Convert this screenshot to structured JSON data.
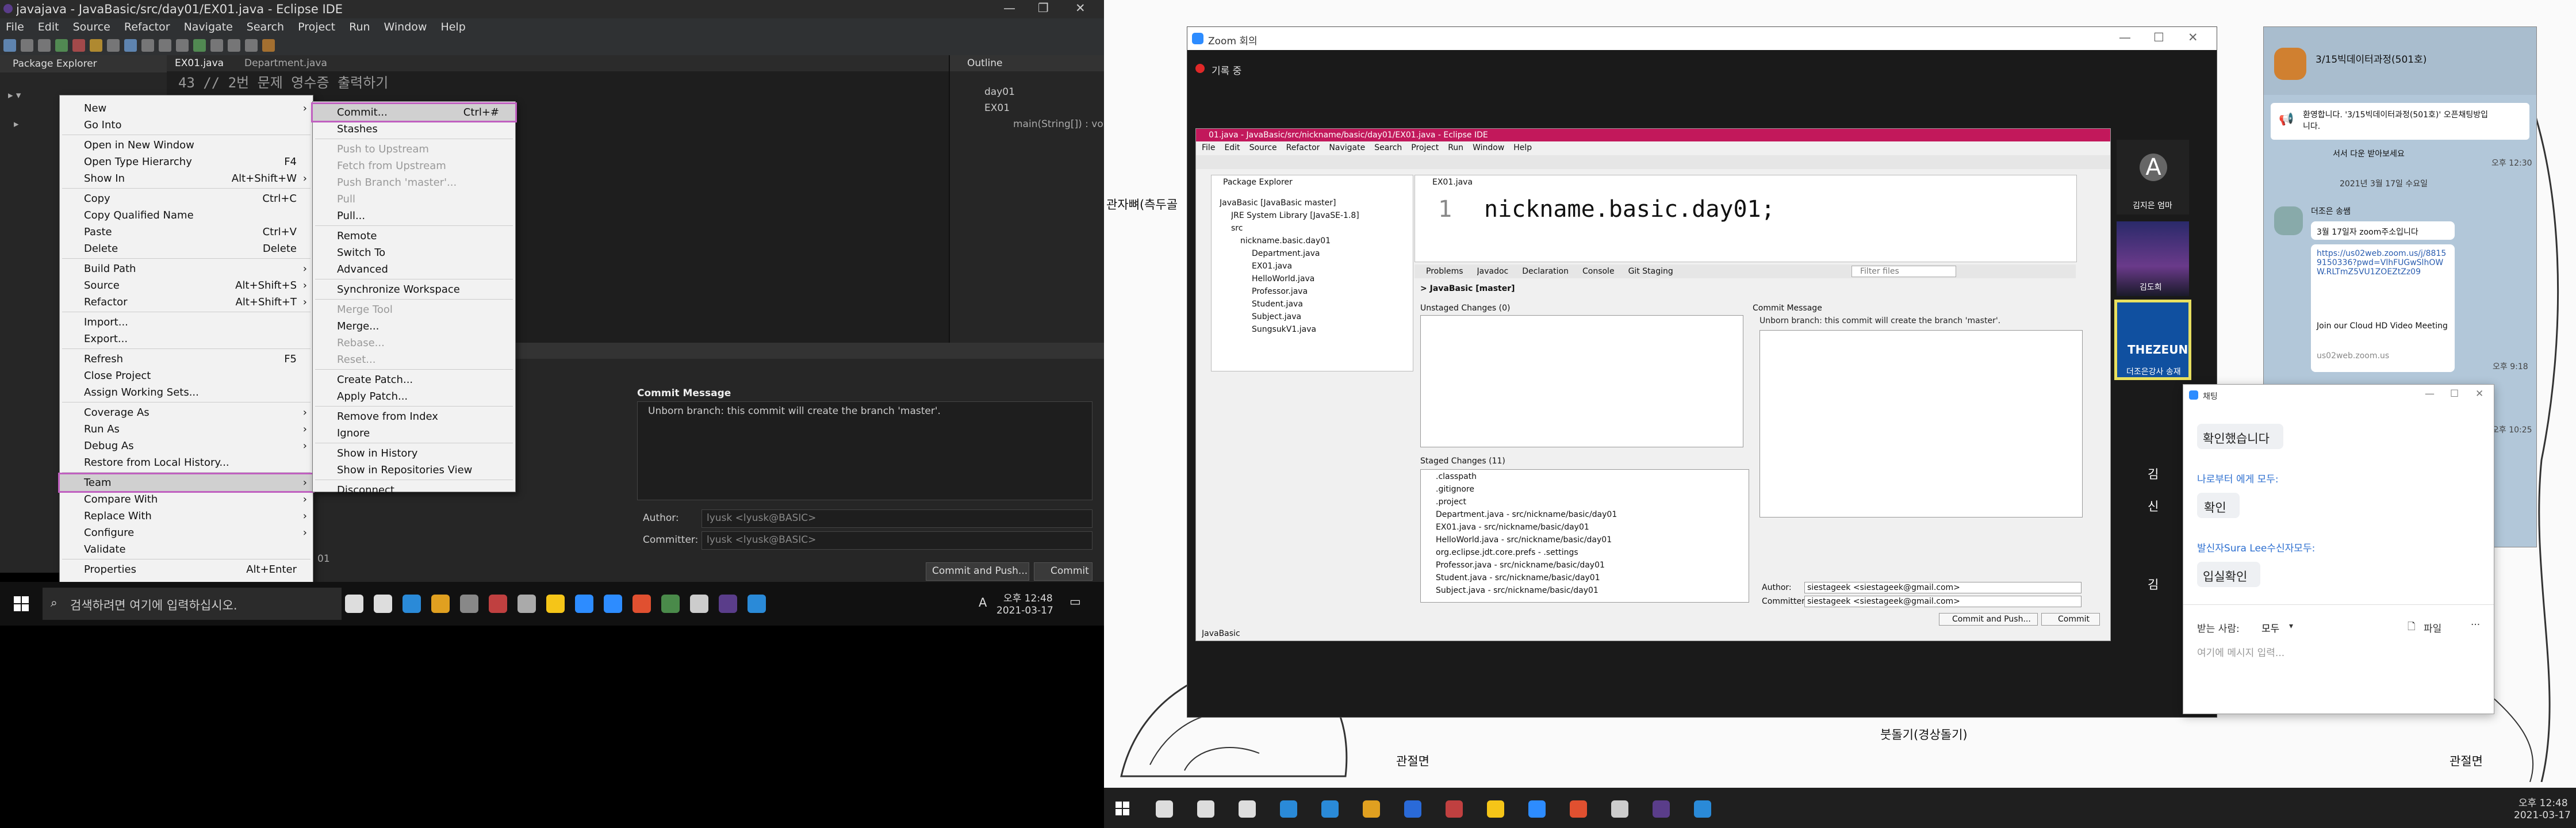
{
  "left_eclipse": {
    "title": "javajava - JavaBasic/src/day01/EX01.java - Eclipse IDE",
    "menubar": [
      "File",
      "Edit",
      "Source",
      "Refactor",
      "Navigate",
      "Search",
      "Project",
      "Run",
      "Window",
      "Help"
    ],
    "package_explorer_tab": "Package Explorer",
    "editor_tabs": [
      "EX01.java",
      "Department.java"
    ],
    "editor_line": "43  // 2번 문제 영수증 출력하기",
    "outline_tab": "Outline",
    "outline_items": [
      "day01",
      "EX01",
      "main(String[]) : void"
    ],
    "context_menu": [
      {
        "label": "New",
        "shortcut": "",
        "arrow": true
      },
      {
        "label": "Go Into",
        "shortcut": "",
        "arrow": false
      },
      {
        "label": "Open in New Window",
        "shortcut": "",
        "arrow": false
      },
      {
        "label": "Open Type Hierarchy",
        "shortcut": "F4",
        "arrow": false
      },
      {
        "label": "Show In",
        "shortcut": "Alt+Shift+W",
        "arrow": true
      },
      {
        "label": "Copy",
        "shortcut": "Ctrl+C",
        "arrow": false
      },
      {
        "label": "Copy Qualified Name",
        "shortcut": "",
        "arrow": false
      },
      {
        "label": "Paste",
        "shortcut": "Ctrl+V",
        "arrow": false
      },
      {
        "label": "Delete",
        "shortcut": "Delete",
        "arrow": false
      },
      {
        "label": "Build Path",
        "shortcut": "",
        "arrow": true
      },
      {
        "label": "Source",
        "shortcut": "Alt+Shift+S",
        "arrow": true
      },
      {
        "label": "Refactor",
        "shortcut": "Alt+Shift+T",
        "arrow": true
      },
      {
        "label": "Import...",
        "shortcut": "",
        "arrow": false
      },
      {
        "label": "Export...",
        "shortcut": "",
        "arrow": false
      },
      {
        "label": "Refresh",
        "shortcut": "F5",
        "arrow": false
      },
      {
        "label": "Close Project",
        "shortcut": "",
        "arrow": false
      },
      {
        "label": "Assign Working Sets...",
        "shortcut": "",
        "arrow": false
      },
      {
        "label": "Coverage As",
        "shortcut": "",
        "arrow": true
      },
      {
        "label": "Run As",
        "shortcut": "",
        "arrow": true
      },
      {
        "label": "Debug As",
        "shortcut": "",
        "arrow": true
      },
      {
        "label": "Restore from Local History...",
        "shortcut": "",
        "arrow": false
      },
      {
        "label": "Team",
        "shortcut": "",
        "arrow": true
      },
      {
        "label": "Compare With",
        "shortcut": "",
        "arrow": true
      },
      {
        "label": "Replace With",
        "shortcut": "",
        "arrow": true
      },
      {
        "label": "Configure",
        "shortcut": "",
        "arrow": true
      },
      {
        "label": "Validate",
        "shortcut": "",
        "arrow": false
      },
      {
        "label": "Properties",
        "shortcut": "Alt+Enter",
        "arrow": false
      }
    ],
    "team_submenu": [
      {
        "label": "Commit...",
        "shortcut": "Ctrl+#",
        "disabled": false
      },
      {
        "label": "Stashes",
        "shortcut": "",
        "disabled": false
      },
      {
        "label": "Push to Upstream",
        "shortcut": "",
        "disabled": true
      },
      {
        "label": "Fetch from Upstream",
        "shortcut": "",
        "disabled": true
      },
      {
        "label": "Push Branch 'master'...",
        "shortcut": "",
        "disabled": true
      },
      {
        "label": "Pull",
        "shortcut": "",
        "disabled": true
      },
      {
        "label": "Pull...",
        "shortcut": "",
        "disabled": false
      },
      {
        "label": "Remote",
        "shortcut": "",
        "disabled": false
      },
      {
        "label": "Switch To",
        "shortcut": "",
        "disabled": false
      },
      {
        "label": "Advanced",
        "shortcut": "",
        "disabled": false
      },
      {
        "label": "Synchronize Workspace",
        "shortcut": "",
        "disabled": false
      },
      {
        "label": "Merge Tool",
        "shortcut": "",
        "disabled": true
      },
      {
        "label": "Merge...",
        "shortcut": "",
        "disabled": false
      },
      {
        "label": "Rebase...",
        "shortcut": "",
        "disabled": true
      },
      {
        "label": "Reset...",
        "shortcut": "",
        "disabled": true
      },
      {
        "label": "Create Patch...",
        "shortcut": "",
        "disabled": false
      },
      {
        "label": "Apply Patch...",
        "shortcut": "",
        "disabled": false
      },
      {
        "label": "Remove from Index",
        "shortcut": "",
        "disabled": false
      },
      {
        "label": "Ignore",
        "shortcut": "",
        "disabled": false
      },
      {
        "label": "Show in History",
        "shortcut": "",
        "disabled": false
      },
      {
        "label": "Show in Repositories View",
        "shortcut": "",
        "disabled": false
      },
      {
        "label": "Disconnect",
        "shortcut": "",
        "disabled": false
      }
    ],
    "commit_message_label": "Commit Message",
    "commit_message_text": "Unborn branch: this commit will create the branch 'master'.",
    "author_label": "Author:",
    "author_value": "lyusk <lyusk@BASIC>",
    "committer_label": "Committer:",
    "committer_value": "lyusk <lyusk@BASIC>",
    "commit_and_push": "Commit and Push...",
    "commit": "Commit",
    "status_01": "01"
  },
  "left_taskbar": {
    "search_placeholder": "검색하려면 여기에 입력하십시오.",
    "time": "오후 12:48",
    "date": "2021-03-17",
    "lang": "A"
  },
  "zoom": {
    "title": "Zoom 회의",
    "recording": "기록 중",
    "inner_title": "01.java - JavaBasic/src/nickname/basic/day01/EX01.java - Eclipse IDE",
    "inner_menu": [
      "File",
      "Edit",
      "Source",
      "Refactor",
      "Navigate",
      "Search",
      "Project",
      "Run",
      "Window",
      "Help"
    ],
    "inner_pkg_tab": "Package Explorer",
    "inner_editor_tab": "EX01.java",
    "inner_tree": [
      "JavaBasic [JavaBasic master]",
      "JRE System Library [JavaSE-1.8]",
      "src",
      "nickname.basic.day01",
      "Department.java",
      "EX01.java",
      "HelloWorld.java",
      "Professor.java",
      "Student.java",
      "Subject.java",
      "SungsukV1.java"
    ],
    "code_line_no": "1",
    "code": "nickname.basic.day01;",
    "bottom_tabs": [
      "Problems",
      "Javadoc",
      "Declaration",
      "Console",
      "Git Staging"
    ],
    "filter_files": "Filter files",
    "repo_header": "> JavaBasic [master]",
    "unstaged": "Unstaged Changes (0)",
    "staged": "Staged Changes (11)",
    "staged_files": [
      ".classpath",
      ".gitignore",
      ".project",
      "Department.java - src/nickname/basic/day01",
      "EX01.java - src/nickname/basic/day01",
      "HelloWorld.java - src/nickname/basic/day01",
      "org.eclipse.jdt.core.prefs - .settings",
      "Professor.java - src/nickname/basic/day01",
      "Student.java - src/nickname/basic/day01",
      "Subject.java - src/nickname/basic/day01"
    ],
    "commit_message": "Commit Message",
    "commit_info": "Unborn branch: this commit will create the branch 'master'.",
    "author_label": "Author:",
    "author_value": "siestageek <siestageek@gmail.com>",
    "committer_label": "Committer:",
    "committer_value": "siestageek <siestageek@gmail.com>",
    "commit_push": "Commit and Push...",
    "commit": "Commit",
    "status": "JavaBasic",
    "participants": [
      {
        "name": "김지은 엄마",
        "initial": "A"
      },
      {
        "name": "김도희",
        "initial": ""
      },
      {
        "name": "더조은강사 송재",
        "initial": ""
      }
    ],
    "thezeun_logo": "THEZEUN",
    "side_labels": [
      "김",
      "신",
      "김"
    ]
  },
  "kakao": {
    "room": "3/15빅데이터과정(501호)",
    "notice": "환영합니다. '3/15빅데이터과정(501호)' 오픈채팅방입니다.",
    "prev_text": "서서 다운 받아보세요",
    "prev_time": "오후 12:30",
    "date_divider": "2021년 3월 17일 수요일",
    "sender": "더조은 송쌤",
    "msg1": "3월 17일자 zoom주소입니다",
    "link": "https://us02web.zoom.us/j/88159150336?pwd=VlhFUGwSlhOWW.RLTmZ5VU1ZOEZtZz09",
    "card_title": "Join our Cloud HD Video Meeting",
    "card_domain": "us02web.zoom.us",
    "msg_time": "오후 9:18",
    "time2": "오후 10:25"
  },
  "zoom_chat": {
    "title": "채팅",
    "top_line": "",
    "msgs": [
      {
        "header": "",
        "text": "확인했습니다"
      },
      {
        "header": "나로부터 에게 모두:",
        "text": "확인"
      },
      {
        "header": "발신자Sura Lee수신자모두:",
        "text": "입실확인"
      }
    ],
    "to_label": "받는 사람:",
    "to_value": "모두",
    "file_label": "파일",
    "input_placeholder": "여기에 메시지 입력..."
  },
  "background_doc": {
    "labels": [
      "관자뼈(측두골",
      "관절면",
      "붓돌기(경상돌기)",
      "관절면"
    ]
  },
  "right_taskbar": {
    "time": "오후 12:48",
    "date": "2021-03-17"
  },
  "colors": {
    "eclipse_dark": "#2b2b2b",
    "menu_highlight": "#c060c0",
    "zoom_blue": "#2d8cff",
    "kakao_bg": "#b2c7d9",
    "git_orange": "#e8a33d"
  }
}
